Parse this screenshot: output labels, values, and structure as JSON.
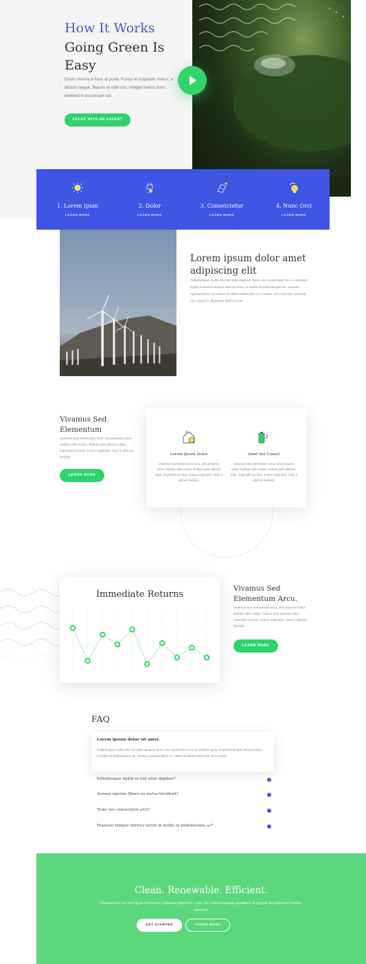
{
  "hero": {
    "title_accent": "How It Works",
    "title_main": "Going Green Is Easy",
    "description": "Etiam viverra a risus at porta. Fusce at vulputate metus, a dictum neque. Mauris et nibh nisi. Integer metus enim, eleifend in accumsan vel.",
    "cta_label": "SPEAK WITH AN EXPERT",
    "play_icon": "play-icon"
  },
  "features": [
    {
      "title": "1. Lorem Ipum",
      "link": "LEARN MORE",
      "icon": "sun-icon"
    },
    {
      "title": "2. Dolor",
      "link": "LEARN MORE",
      "icon": "plug-icon"
    },
    {
      "title": "3. Consetctetur",
      "link": "LEARN MORE",
      "icon": "solar-panel-icon"
    },
    {
      "title": "4. Nunc Orci",
      "link": "LEARN MORE",
      "icon": "bulb-icon"
    }
  ],
  "wind": {
    "title": "Lorem ipsum dolor amet adipiscing elit",
    "description": "Pellentesque mollis nisi nisl vitae dapibus. Nunc nec consectetur orci, et sodales ligula. Praesent tempor ultrices tortor, in mollis ex pellentesque ac. Aenean egestas libero eu metus tincidunt sollicitudin at in neque. Sed eros est, vehicula non neque a, dignissim eleifend nisl."
  },
  "vivamus": {
    "title": "Vivamus Sed Elementum",
    "description": "Vivamus sed elementum arcu, sed posuere tortor. Nullam nibh metus, finibus quis ultricies vitae, imperdiet at risus. Fusce imperdiet, risus a ultrices facilisis.",
    "cta_label": "LEARN MORE",
    "card": [
      {
        "title": "Lorem Ipsum Dolor",
        "description": "Vivamus sed elementum arcu, sed posuere tortor. Nullam nibh metus, finibus quis ultricies vitae, imperdiet at risus. Fusce imperdiet, risus a ultrices facilisis.",
        "icon": "eco-house-icon"
      },
      {
        "title": "Amet Set Consel",
        "description": "Vivamus sed elementum arcu, sed posuere tortor. Nullam nibh metus, finibus quis ultricies vitae, imperdiet at risus. Fusce imperdiet, risus a ultrices facilisis.",
        "icon": "battery-plug-icon"
      }
    ]
  },
  "chart_data": {
    "type": "line",
    "title": "Immediate Returns",
    "xlabel": "",
    "ylabel": "",
    "x": [
      1,
      2,
      3,
      4,
      5,
      6,
      7,
      8,
      9,
      10
    ],
    "values": [
      7,
      2,
      6,
      4.5,
      6.8,
      1.5,
      4.7,
      2.5,
      4,
      2.5
    ],
    "ylim": [
      0,
      10
    ],
    "grid": true,
    "color": "#34d46c"
  },
  "returns": {
    "title": "Vivamus Sed Elementum Arcu.",
    "description": "Vivamus sed elementum arcu, sed posuere tortor. Nullam nibh metus, finibus quis ultricies vitae, imperdiet at risus. Fusce imperdiet, risus a ultrices facilisis.",
    "cta_label": "LEARN MORE"
  },
  "faq": {
    "title": "FAQ",
    "open_question": "Lorem ipsum dolor sit amet.",
    "open_answer": "Pellentesque mollis nisi nisl vitae dapibus. Nunc nec consectetur orci, et sodales ligula. Praesent tempor ultrices tortor, in mollis ex pellentesque ac. Aenean egestas libero eu metus tincidunt sollicitudin at in neque.",
    "items": [
      "Pellentesque mollis in nisl vitae dapibus?",
      "Aenean egestas libero eu metus tincidunt?",
      "Nunc nec consectetur orci?",
      "Praesent tempor ultrices tortor in mollis ex pellentesque ac?"
    ]
  },
  "cta": {
    "title": "Clean. Renewable. Efficient.",
    "description": "Vivamus non orci non ligula fermentum vulputate imperdiet a nisl. Orci varius natoque penatibus et magnis dis parturient montes, nascetur.",
    "primary_label": "GET STARTED",
    "secondary_label": "LEARN MORE"
  },
  "colors": {
    "accent_blue": "#3f55e3",
    "accent_green": "#34d46c",
    "cta_green": "#5bd77c"
  }
}
